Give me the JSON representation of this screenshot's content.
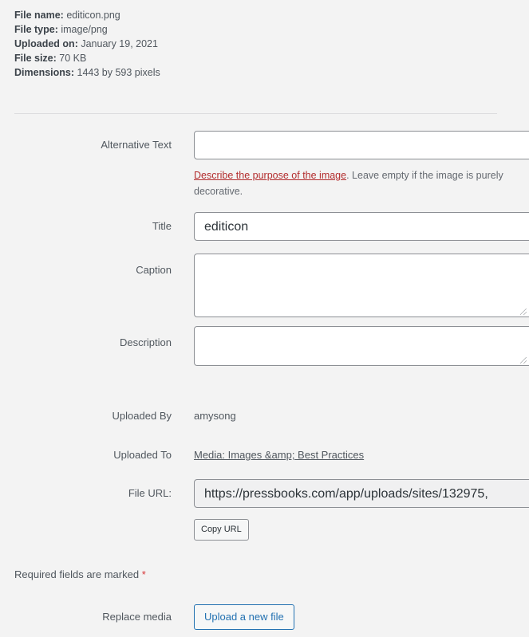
{
  "file_info": {
    "file_name_label": "File name:",
    "file_name": "editicon.png",
    "file_type_label": "File type:",
    "file_type": "image/png",
    "uploaded_on_label": "Uploaded on:",
    "uploaded_on": "January 19, 2021",
    "file_size_label": "File size:",
    "file_size": "70 KB",
    "dimensions_label": "Dimensions:",
    "dimensions": "1443 by 593 pixels"
  },
  "fields": {
    "alt_text_label": "Alternative Text",
    "alt_text_value": "",
    "alt_hint_link": "Describe the purpose of the image",
    "alt_hint_rest": ". Leave empty if the image is purely decorative.",
    "title_label": "Title",
    "title_value": "editicon",
    "caption_label": "Caption",
    "caption_value": "",
    "description_label": "Description",
    "description_value": "",
    "uploaded_by_label": "Uploaded By",
    "uploaded_by_value": "amysong",
    "uploaded_to_label": "Uploaded To",
    "uploaded_to_value": "Media: Images &amp; Best Practices",
    "file_url_label": "File URL:",
    "file_url_value": "https://pressbooks.com/app/uploads/sites/132975,",
    "copy_url_button": "Copy URL"
  },
  "required_note": "Required fields are marked",
  "required_star": "*",
  "replace_media_label": "Replace media",
  "upload_button": "Upload a new file"
}
